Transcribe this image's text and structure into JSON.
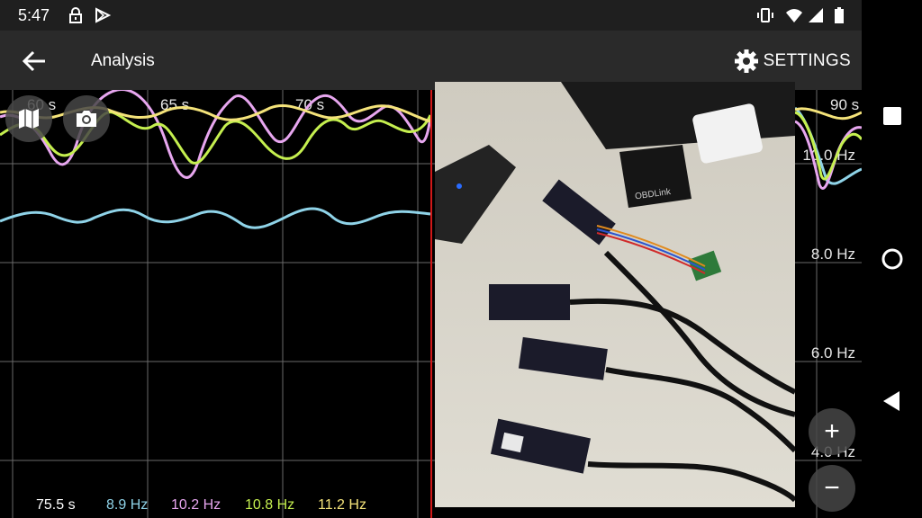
{
  "status_bar": {
    "time": "5:47",
    "icons": [
      "lock-icon",
      "play-store-icon",
      "vibrate-icon",
      "wifi-icon",
      "signal-icon",
      "battery-icon"
    ]
  },
  "app_bar": {
    "title": "Analysis",
    "settings_label": "SETTINGS"
  },
  "chart": {
    "x_ticks": [
      "60 s",
      "65 s",
      "70 s",
      "90 s"
    ],
    "y_ticks": [
      "10.0 Hz",
      "8.0 Hz",
      "6.0 Hz",
      "4.0 Hz"
    ],
    "series": [
      {
        "name": "8.9 Hz",
        "color": "#8fd3e8"
      },
      {
        "name": "10.2 Hz",
        "color": "#e7a6ef"
      },
      {
        "name": "10.8 Hz",
        "color": "#c5ef4f"
      },
      {
        "name": "11.2 Hz",
        "color": "#f4e37a"
      }
    ],
    "cursor_time": "75.5 s",
    "cursor_color": "#d01818"
  },
  "chart_data": {
    "type": "line",
    "xlabel": "",
    "ylabel": "",
    "x_ticks": [
      "60 s",
      "65 s",
      "70 s",
      "90 s"
    ],
    "y_ticks": [
      "10.0 Hz",
      "8.0 Hz",
      "6.0 Hz",
      "4.0 Hz"
    ],
    "series": [
      {
        "name": "8.9 Hz",
        "values_hz": [
          8.9,
          9.0,
          8.8,
          9.0,
          8.9,
          8.8,
          9.0,
          8.9,
          8.8,
          9.0,
          8.9
        ]
      },
      {
        "name": "10.2 Hz",
        "values_hz": [
          11.0,
          11.8,
          10.2,
          11.7,
          11.4,
          10.5,
          11.8,
          11.6,
          10.9,
          11.6,
          10.2
        ]
      },
      {
        "name": "10.8 Hz",
        "values_hz": [
          10.6,
          11.3,
          10.4,
          11.0,
          11.2,
          10.6,
          11.4,
          10.5,
          10.8,
          11.4,
          10.0
        ]
      },
      {
        "name": "11.2 Hz",
        "values_hz": [
          11.2,
          11.4,
          11.0,
          11.3,
          11.5,
          11.1,
          11.3,
          11.4,
          11.0,
          11.3,
          11.5
        ]
      }
    ]
  },
  "fabs": {
    "zoom_in": "+",
    "zoom_out": "−"
  },
  "photo": {
    "device_label": "OBDLink"
  }
}
